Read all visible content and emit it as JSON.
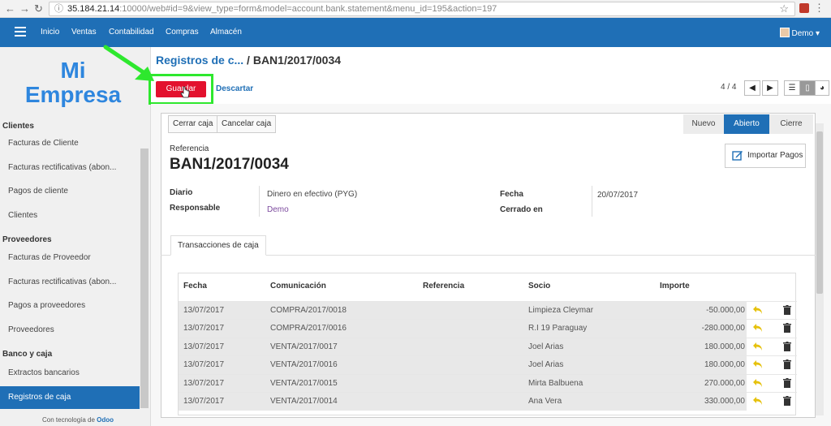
{
  "browser": {
    "url_host": "35.184.21.14",
    "url_rest": ":10000/web#id=9&view_type=form&model=account.bank.statement&menu_id=195&action=197",
    "back": "←",
    "forward": "→",
    "reload": "↻",
    "star": "☆",
    "menu": "⋮"
  },
  "topnav": {
    "items": [
      "Inicio",
      "Ventas",
      "Contabilidad",
      "Compras",
      "Almacén"
    ],
    "user": "Demo"
  },
  "sidebar": {
    "logo_line1": "Mi",
    "logo_line2": "Empresa",
    "clients_head": "Clientes",
    "client_items": [
      "Facturas de Cliente",
      "Facturas rectificativas (abon...",
      "Pagos de cliente",
      "Clientes"
    ],
    "providers_head": "Proveedores",
    "provider_items": [
      "Facturas de Proveedor",
      "Facturas rectificativas (abon...",
      "Pagos a proveedores",
      "Proveedores"
    ],
    "bank_head": "Banco y caja",
    "bank_items": [
      "Extractos bancarios",
      "Registros de caja"
    ],
    "powered_prefix": "Con tecnología de",
    "powered_brand": "Odoo"
  },
  "breadcrumb": {
    "parent": "Registros de c...",
    "separator": "/",
    "current": "BAN1/2017/0034"
  },
  "actions": {
    "save": "Guardar",
    "discard": "Descartar",
    "pager": "4 / 4"
  },
  "statement": {
    "buttons": [
      "Cerrar caja",
      "Cancelar caja"
    ],
    "stages": [
      "Nuevo",
      "Abierto",
      "Cierre"
    ],
    "ref_label": "Referencia",
    "ref_value": "BAN1/2017/0034",
    "import_label": "Importar Pagos",
    "diario_label": "Diario",
    "diario_value": "Dinero en efectivo (PYG)",
    "resp_label": "Responsable",
    "resp_value": "Demo",
    "fecha_label": "Fecha",
    "fecha_value": "20/07/2017",
    "cerrado_label": "Cerrado en",
    "tab": "Transacciones de caja"
  },
  "table": {
    "headers": [
      "Fecha",
      "Comunicación",
      "Referencia",
      "Socio",
      "Importe"
    ],
    "rows": [
      {
        "fecha": "13/07/2017",
        "com": "COMPRA/2017/0018",
        "ref": "",
        "socio": "Limpieza Cleymar",
        "importe": "-50.000,00"
      },
      {
        "fecha": "13/07/2017",
        "com": "COMPRA/2017/0016",
        "ref": "",
        "socio": "R.I 19 Paraguay",
        "importe": "-280.000,00"
      },
      {
        "fecha": "13/07/2017",
        "com": "VENTA/2017/0017",
        "ref": "",
        "socio": "Joel Arias",
        "importe": "180.000,00"
      },
      {
        "fecha": "13/07/2017",
        "com": "VENTA/2017/0016",
        "ref": "",
        "socio": "Joel Arias",
        "importe": "180.000,00"
      },
      {
        "fecha": "13/07/2017",
        "com": "VENTA/2017/0015",
        "ref": "",
        "socio": "Mirta Balbuena",
        "importe": "270.000,00"
      },
      {
        "fecha": "13/07/2017",
        "com": "VENTA/2017/0014",
        "ref": "",
        "socio": "Ana Vera",
        "importe": "330.000,00"
      }
    ]
  },
  "colors": {
    "brand": "#1f6fb6",
    "save": "#e3112e",
    "highlight": "#2ee82e"
  }
}
